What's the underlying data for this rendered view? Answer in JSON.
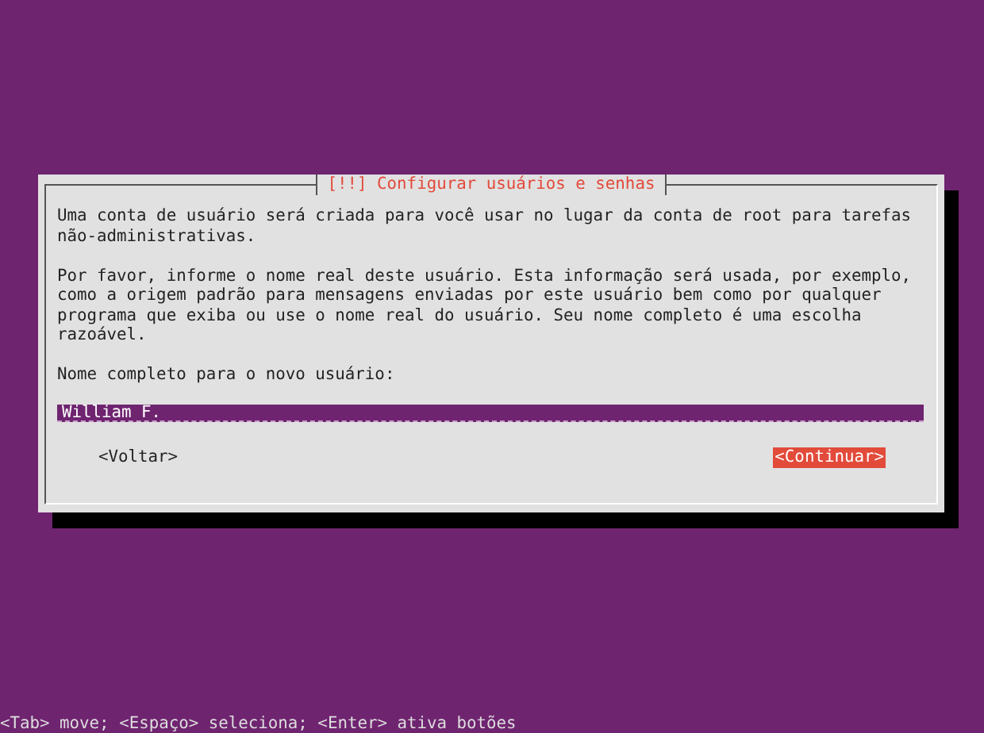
{
  "dialog": {
    "title": "[!!] Configurar usuários e senhas",
    "paragraphs": [
      "Uma conta de usuário será criada para você usar no lugar da conta de root para tarefas não-administrativas.",
      "Por favor, informe o nome real deste usuário. Esta informação será usada, por exemplo, como a origem padrão para mensagens enviadas por este usuário bem como por qualquer programa que exiba ou use o nome real do usuário. Seu nome completo é uma escolha razoável."
    ],
    "field_label": "Nome completo para o novo usuário:",
    "field": {
      "value": "William F.",
      "focused": true
    },
    "buttons": [
      {
        "label": "<Voltar>",
        "selected": false
      },
      {
        "label": "<Continuar>",
        "selected": true
      }
    ]
  },
  "status_bar": "<Tab> move; <Espaço> seleciona; <Enter> ativa botões"
}
